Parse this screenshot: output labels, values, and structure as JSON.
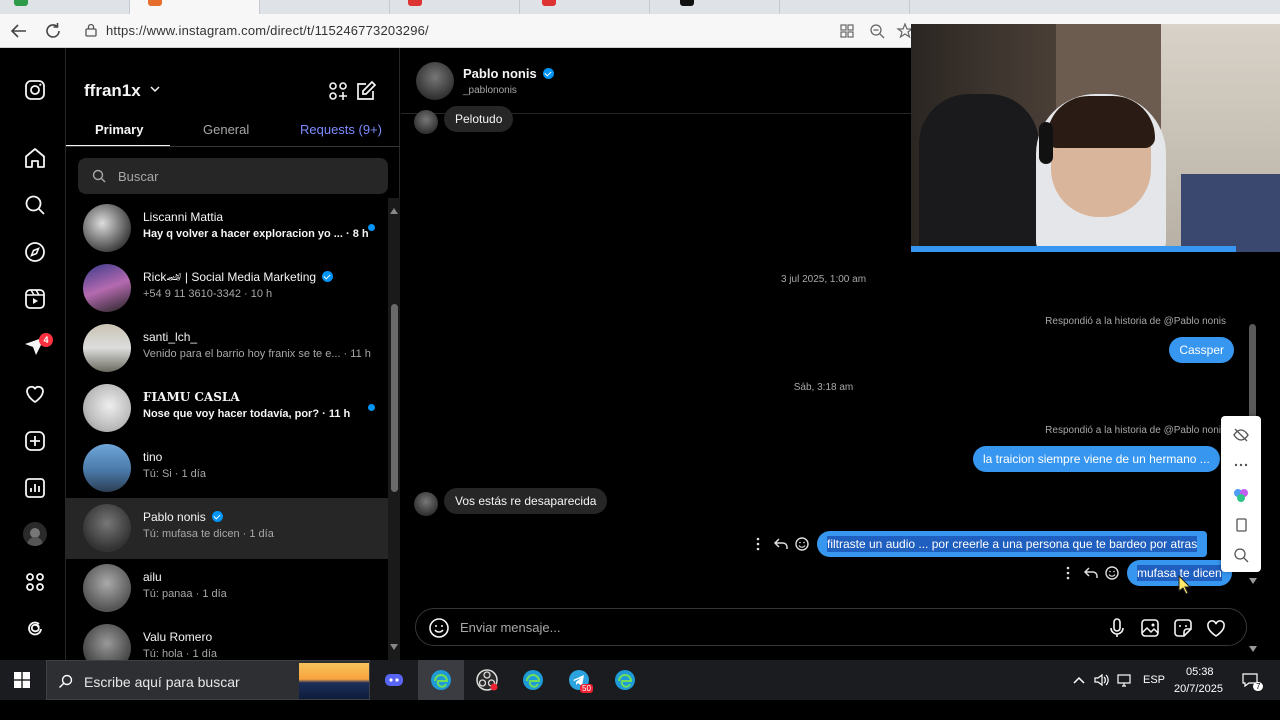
{
  "browser": {
    "url": "https://www.instagram.com/direct/t/115246773203296/"
  },
  "ig": {
    "username": "ffran1x",
    "notification_count": "4",
    "tabs": {
      "primary": "Primary",
      "general": "General",
      "requests": "Requests (9+)"
    },
    "search_placeholder": "Buscar",
    "conversations": [
      {
        "name": "Liscanni Mattia",
        "preview": "Hay q volver a hacer exploracion yo ... · 8 h",
        "unread": true,
        "verified": false,
        "bold": true
      },
      {
        "name": "Rick🏎 | Social Media Marketing",
        "preview": "+54 9 11 3610-3342 · 10 h",
        "unread": false,
        "verified": true,
        "bold": false
      },
      {
        "name": "santi_lch_",
        "preview": "Venido para el barrio hoy franix se te e... · 11 h",
        "unread": false,
        "verified": false,
        "bold": false
      },
      {
        "name": "𝐅𝐈𝐀𝐌𝐔 𝐂𝐀𝐒𝐋𝐀",
        "preview": "Nose que voy hacer todavía, por? · 11 h",
        "unread": true,
        "verified": false,
        "bold": true
      },
      {
        "name": "tino",
        "preview": "Tú: Si · 1 día",
        "unread": false,
        "verified": false,
        "bold": false
      },
      {
        "name": "Pablo nonis",
        "preview": "Tú: mufasa te dicen · 1 día",
        "unread": false,
        "verified": true,
        "bold": false,
        "selected": true
      },
      {
        "name": "ailu",
        "preview": "Tú: panaa · 1 día",
        "unread": false,
        "verified": false,
        "bold": false
      },
      {
        "name": "Valu Romero",
        "preview": "Tú: hola · 1 día",
        "unread": false,
        "verified": false,
        "bold": false
      }
    ],
    "chat": {
      "name": "Pablo nonis",
      "handle": "_pablononis",
      "messages": {
        "m1": "Pelotudo",
        "date1": "3 jul 2025, 1:00 am",
        "reply1": "Respondió a la historia de @Pablo nonis",
        "m2": "Cassper",
        "date2": "Sáb, 3:18 am",
        "reply2": "Respondió a la historia de @Pablo nonis",
        "m3": "la traicion siempre viene de un hermano ...",
        "m4": "Vos estás re desaparecida",
        "m5": "filtraste un audio ... por creerle a una persona que te bardeo por atras",
        "m6": "mufasa te dicen"
      },
      "composer_placeholder": "Enviar mensaje..."
    }
  },
  "taskbar": {
    "search_placeholder": "Escribe aquí para buscar",
    "telegram_badge": "50",
    "language": "ESP",
    "time": "05:38",
    "date": "20/7/2025",
    "notif_count": "7"
  },
  "colors": {
    "accent": "#3797f0",
    "verified": "#0095f6",
    "badge": "#ff3040"
  }
}
